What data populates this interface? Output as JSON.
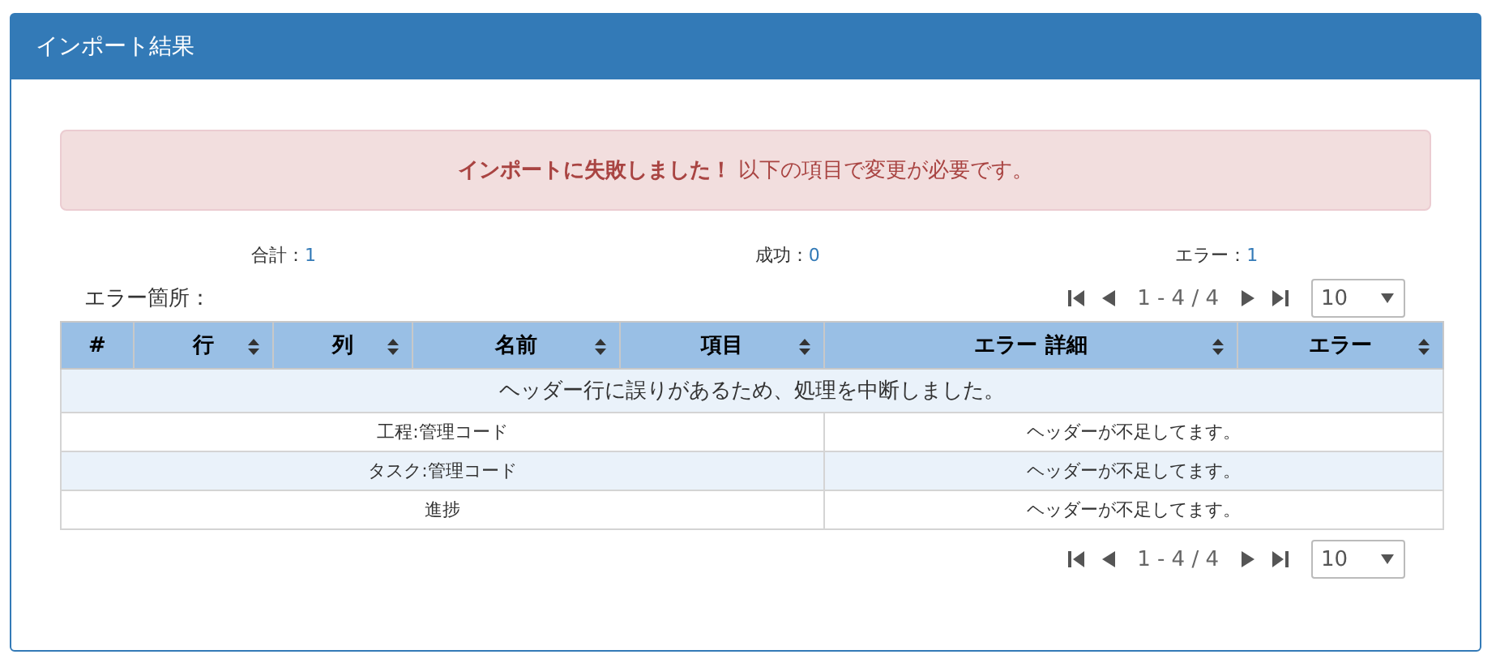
{
  "panel": {
    "title": "インポート結果"
  },
  "alert": {
    "strong": "インポートに失敗しました！",
    "message": "以下の項目で変更が必要です。"
  },
  "summary": [
    {
      "label": "合計：",
      "value": "1"
    },
    {
      "label": "成功：",
      "value": "0"
    },
    {
      "label": "エラー：",
      "value": "1"
    }
  ],
  "error_location_label": "エラー箇所：",
  "pager_top": {
    "range": "1 - 4 / 4",
    "page_size": "10"
  },
  "table": {
    "columns": [
      {
        "label": "#",
        "sortable": false
      },
      {
        "label": "行",
        "sortable": true
      },
      {
        "label": "列",
        "sortable": true
      },
      {
        "label": "名前",
        "sortable": true
      },
      {
        "label": "項目",
        "sortable": true
      },
      {
        "label": "エラー 詳細",
        "sortable": true
      },
      {
        "label": "エラー",
        "sortable": true
      }
    ],
    "rows": [
      {
        "kind": "message",
        "text": "ヘッダー行に誤りがあるため、処理を中断しました。"
      },
      {
        "kind": "pair",
        "item": "工程:管理コード",
        "detail": "ヘッダーが不足してます。"
      },
      {
        "kind": "pair",
        "item": "タスク:管理コード",
        "detail": "ヘッダーが不足してます。"
      },
      {
        "kind": "pair",
        "item": "進捗",
        "detail": "ヘッダーが不足してます。"
      }
    ]
  },
  "pager_bottom": {
    "range": "1 - 4 / 4",
    "page_size": "10"
  }
}
